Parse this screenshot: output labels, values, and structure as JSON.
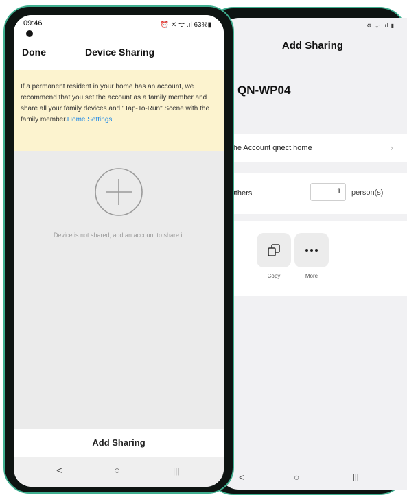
{
  "back": {
    "status_icons": "⚙ ᯤ .ıl ▮",
    "title": "Add Sharing",
    "device_name": "QN-WP04",
    "share_account_text": "ith the Account qnect home",
    "share_others_label": "th Others",
    "person_count": "1",
    "person_unit": "person(s)",
    "options": [
      {
        "label": "Copy",
        "icon": "copy-icon"
      },
      {
        "label": "More",
        "icon": "more-icon"
      }
    ],
    "nav": {
      "back": "<",
      "home": "○",
      "recents": "|||"
    }
  },
  "front": {
    "status_time": "09:46",
    "status_right": "⏰ ✕ ᯤ .ıl 63%▮",
    "done_label": "Done",
    "title": "Device Sharing",
    "notice_text": "If a permanent resident in your home has an account, we recommend that you set the account as a family member and share all your family devices and \"Tap-To-Run\" Scene with the family member.",
    "notice_link": "Home Settings",
    "empty_message": "Device is not shared, add an account to share it",
    "add_sharing_label": "Add Sharing",
    "nav": {
      "back": "<",
      "home": "○",
      "recents": "|||"
    }
  },
  "colors": {
    "accent_link": "#1e88e5",
    "notice_bg": "#fcf3cf",
    "phone_frame": "#3fae8f"
  }
}
